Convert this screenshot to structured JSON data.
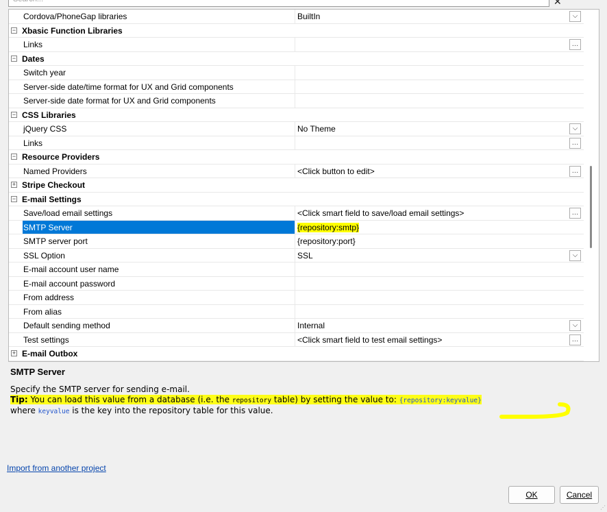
{
  "search": {
    "placeholder": "Search..."
  },
  "close_icon": "✕",
  "grid": {
    "rows": [
      {
        "type": "prop",
        "name": "Cordova/PhoneGap libraries",
        "value": "BuiltIn",
        "control": "dropdown"
      },
      {
        "type": "category",
        "name": "Xbasic Function Libraries",
        "expanded": true
      },
      {
        "type": "prop",
        "name": "Links",
        "value": "",
        "control": "ellipsis"
      },
      {
        "type": "category",
        "name": "Dates",
        "expanded": true
      },
      {
        "type": "prop",
        "name": "Switch year",
        "value": ""
      },
      {
        "type": "prop",
        "name": "Server-side date/time format for UX and Grid components",
        "value": ""
      },
      {
        "type": "prop",
        "name": "Server-side date format for UX and Grid components",
        "value": ""
      },
      {
        "type": "category",
        "name": "CSS Libraries",
        "expanded": true
      },
      {
        "type": "prop",
        "name": "jQuery CSS",
        "value": "No Theme",
        "control": "dropdown"
      },
      {
        "type": "prop",
        "name": "Links",
        "value": "",
        "control": "ellipsis"
      },
      {
        "type": "category",
        "name": "Resource Providers",
        "expanded": true
      },
      {
        "type": "prop",
        "name": "Named Providers",
        "value": "<Click button to edit>",
        "control": "ellipsis"
      },
      {
        "type": "category",
        "name": "Stripe Checkout",
        "expanded": false
      },
      {
        "type": "category",
        "name": "E-mail Settings",
        "expanded": true
      },
      {
        "type": "prop",
        "name": "Save/load email settings",
        "value": "<Click smart field to save/load email settings>",
        "control": "ellipsis"
      },
      {
        "type": "prop",
        "name": "SMTP Server",
        "value": "{repository:smtp}",
        "selected": true
      },
      {
        "type": "prop",
        "name": "SMTP server port",
        "value": "{repository:port}"
      },
      {
        "type": "prop",
        "name": "SSL Option",
        "value": "SSL",
        "control": "dropdown"
      },
      {
        "type": "prop",
        "name": "E-mail account user name",
        "value": ""
      },
      {
        "type": "prop",
        "name": "E-mail account password",
        "value": ""
      },
      {
        "type": "prop",
        "name": "From address",
        "value": ""
      },
      {
        "type": "prop",
        "name": "From alias",
        "value": ""
      },
      {
        "type": "prop",
        "name": "Default sending method",
        "value": "Internal",
        "control": "dropdown"
      },
      {
        "type": "prop",
        "name": "Test settings",
        "value": "<Click smart field to test email settings>",
        "control": "ellipsis"
      },
      {
        "type": "category",
        "name": "E-mail Outbox",
        "expanded": false
      }
    ]
  },
  "description": {
    "title": "SMTP Server",
    "line1": "Specify the SMTP server for sending e-mail.",
    "tip_label": "Tip:",
    "tip_text_1": " You can load this value from a database (i.e. the ",
    "tip_code_1": "repository",
    "tip_text_2": " table) by setting the value to: ",
    "tip_code_2": "{repository:keyvalue}",
    "line3_text_1": "where ",
    "line3_code": "keyvalue",
    "line3_text_2": " is the key into the repository table for this value."
  },
  "footer": {
    "import_link": "Import from another project",
    "ok_label": "OK",
    "cancel_label": "Cancel"
  },
  "colors": {
    "selection": "#0078d7",
    "highlight": "#ffff00",
    "link": "#0645ad"
  }
}
